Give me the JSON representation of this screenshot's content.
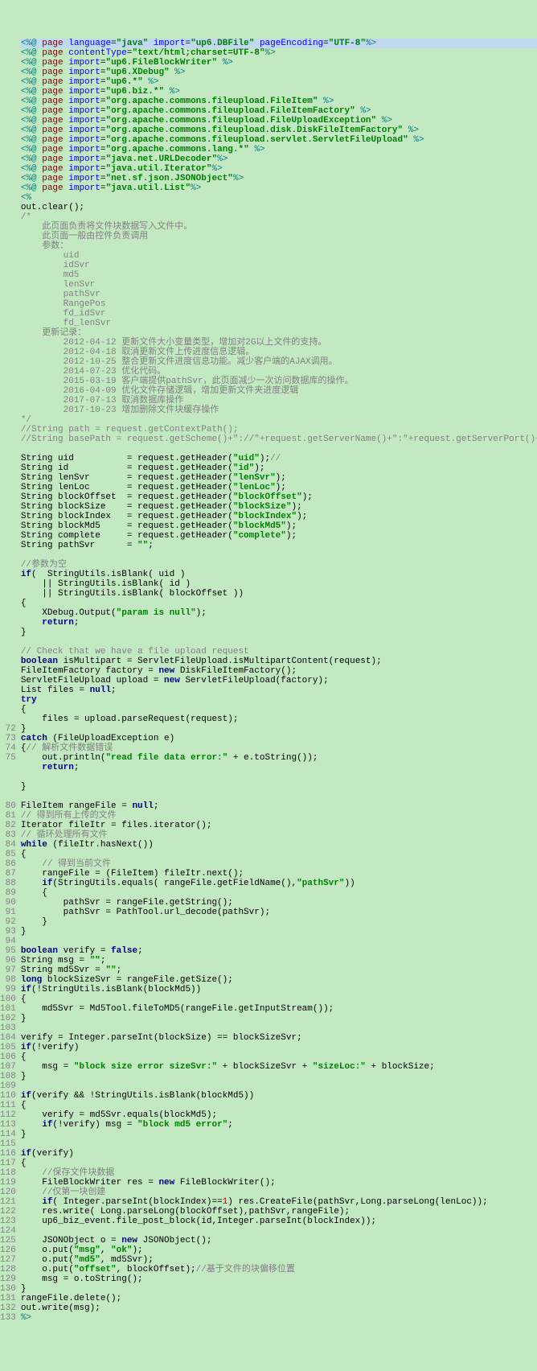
{
  "gutter": [
    "",
    "",
    "",
    "",
    "",
    "",
    "",
    "",
    "",
    "",
    "",
    "",
    "",
    "",
    "",
    "",
    "",
    "",
    "",
    "",
    "",
    "",
    "",
    "",
    "",
    "",
    "",
    "",
    "",
    "",
    "",
    "",
    "",
    "",
    "",
    "",
    "",
    "",
    "",
    "",
    "",
    "",
    "",
    "",
    "",
    "",
    "",
    "",
    "",
    "",
    "",
    "",
    "",
    "",
    "",
    "",
    "",
    "",
    "",
    "",
    "",
    "",
    "",
    "",
    "",
    "",
    "",
    "",
    "",
    "",
    "",
    "72",
    "73",
    "74",
    "75",
    "",
    "",
    "",
    "",
    "80",
    "81",
    "82",
    "83",
    "84",
    "85",
    "86",
    "87",
    "88",
    "89",
    "90",
    "91",
    "92",
    "93",
    "94",
    "95",
    "96",
    "97",
    "98",
    "99",
    "100",
    "101",
    "102",
    "103",
    "104",
    "105",
    "106",
    "107",
    "108",
    "109",
    "110",
    "111",
    "112",
    "113",
    "114",
    "115",
    "116",
    "117",
    "118",
    "119",
    "120",
    "121",
    "122",
    "123",
    "124",
    "125",
    "126",
    "127",
    "128",
    "129",
    "130",
    "131",
    "132",
    "133"
  ],
  "lines": [
    {
      "cls": "highlight-line",
      "h": "<span class='tag'>&lt;%@</span> <span class='brown'>page</span> <span class='attr'>language</span>=<span class='str'>\"java\"</span> <span class='attr'>import</span>=<span class='str'>\"up6.DBFile\"</span> <span class='attr'>pageEncoding</span>=<span class='str'>\"UTF-8\"</span><span class='tag'>%&gt;</span>"
    },
    {
      "h": "<span class='tag'>&lt;%@</span> <span class='brown'>page</span> <span class='attr'>contentType</span>=<span class='str'>\"text/html;charset=UTF-8\"</span><span class='tag'>%&gt;</span>"
    },
    {
      "h": "<span class='tag'>&lt;%@</span> <span class='brown'>page</span> <span class='attr'>import</span>=<span class='str'>\"up6.FileBlockWriter\"</span> <span class='tag'>%&gt;</span>"
    },
    {
      "h": "<span class='tag'>&lt;%@</span> <span class='brown'>page</span> <span class='attr'>import</span>=<span class='str'>\"up6.XDebug\"</span> <span class='tag'>%&gt;</span>"
    },
    {
      "h": "<span class='tag'>&lt;%@</span> <span class='brown'>page</span> <span class='attr'>import</span>=<span class='str'>\"up6.*\"</span> <span class='tag'>%&gt;</span>"
    },
    {
      "h": "<span class='tag'>&lt;%@</span> <span class='brown'>page</span> <span class='attr'>import</span>=<span class='str'>\"up6.biz.*\"</span> <span class='tag'>%&gt;</span>"
    },
    {
      "h": "<span class='tag'>&lt;%@</span> <span class='brown'>page</span> <span class='attr'>import</span>=<span class='str'>\"org.apache.commons.fileupload.FileItem\"</span> <span class='tag'>%&gt;</span>"
    },
    {
      "h": "<span class='tag'>&lt;%@</span> <span class='brown'>page</span> <span class='attr'>import</span>=<span class='str'>\"org.apache.commons.fileupload.FileItemFactory\"</span> <span class='tag'>%&gt;</span>"
    },
    {
      "h": "<span class='tag'>&lt;%@</span> <span class='brown'>page</span> <span class='attr'>import</span>=<span class='str'>\"org.apache.commons.fileupload.FileUploadException\"</span> <span class='tag'>%&gt;</span>"
    },
    {
      "h": "<span class='tag'>&lt;%@</span> <span class='brown'>page</span> <span class='attr'>import</span>=<span class='str'>\"org.apache.commons.fileupload.disk.DiskFileItemFactory\"</span> <span class='tag'>%&gt;</span>"
    },
    {
      "h": "<span class='tag'>&lt;%@</span> <span class='brown'>page</span> <span class='attr'>import</span>=<span class='str'>\"org.apache.commons.fileupload.servlet.ServletFileUpload\"</span> <span class='tag'>%&gt;</span>"
    },
    {
      "h": "<span class='tag'>&lt;%@</span> <span class='brown'>page</span> <span class='attr'>import</span>=<span class='str'>\"org.apache.commons.lang.*\"</span> <span class='tag'>%&gt;</span>"
    },
    {
      "h": "<span class='tag'>&lt;%@</span> <span class='brown'>page</span> <span class='attr'>import</span>=<span class='str'>\"java.net.URLDecoder\"</span><span class='tag'>%&gt;</span>"
    },
    {
      "h": "<span class='tag'>&lt;%@</span> <span class='brown'>page</span> <span class='attr'>import</span>=<span class='str'>\"java.util.Iterator\"</span><span class='tag'>%&gt;</span>"
    },
    {
      "h": "<span class='tag'>&lt;%@</span> <span class='brown'>page</span> <span class='attr'>import</span>=<span class='str'>\"net.sf.json.JSONObject\"</span><span class='tag'>%&gt;</span>"
    },
    {
      "h": "<span class='tag'>&lt;%@</span> <span class='brown'>page</span> <span class='attr'>import</span>=<span class='str'>\"java.util.List\"</span><span class='tag'>%&gt;</span>"
    },
    {
      "h": "<span class='tag'>&lt;%</span>"
    },
    {
      "h": "out.clear();"
    },
    {
      "h": "<span class='cmt'>/*</span>"
    },
    {
      "h": "<span class='cmt'>    此页面负责将文件块数据写入文件中。</span>"
    },
    {
      "h": "<span class='cmt'>    此页面一般由控件负责调用</span>"
    },
    {
      "h": "<span class='cmt'>    参数：</span>"
    },
    {
      "h": "<span class='cmt'>        uid</span>"
    },
    {
      "h": "<span class='cmt'>        idSvr</span>"
    },
    {
      "h": "<span class='cmt'>        md5</span>"
    },
    {
      "h": "<span class='cmt'>        lenSvr</span>"
    },
    {
      "h": "<span class='cmt'>        pathSvr</span>"
    },
    {
      "h": "<span class='cmt'>        RangePos</span>"
    },
    {
      "h": "<span class='cmt'>        fd_idSvr</span>"
    },
    {
      "h": "<span class='cmt'>        fd_lenSvr</span>"
    },
    {
      "h": "<span class='cmt'>    更新记录：</span>"
    },
    {
      "h": "<span class='cmt'>        2012-04-12 更新文件大小变量类型，增加对2G以上文件的支持。</span>"
    },
    {
      "h": "<span class='cmt'>        2012-04-18 取消更新文件上传进度信息逻辑。</span>"
    },
    {
      "h": "<span class='cmt'>        2012-10-25 整合更新文件进度信息功能。减少客户端的AJAX调用。</span>"
    },
    {
      "h": "<span class='cmt'>        2014-07-23 优化代码。</span>"
    },
    {
      "h": "<span class='cmt'>        2015-03-19 客户端提供pathSvr，此页面减少一次访问数据库的操作。</span>"
    },
    {
      "h": "<span class='cmt'>        2016-04-09 优化文件存储逻辑，增加更新文件夹进度逻辑</span>"
    },
    {
      "h": "<span class='cmt'>        2017-07-13 取消数据库操作</span>"
    },
    {
      "h": "<span class='cmt'>        2017-10-23 增加删除文件块缓存操作</span>"
    },
    {
      "h": "<span class='cmt'>*/</span>"
    },
    {
      "h": "<span class='cmt'>//String path = request.getContextPath();</span>"
    },
    {
      "h": "<span class='cmt'>//String basePath = request.getScheme()+\"://\"+request.getServerName()+\":\"+request.getServerPort()+path+\"/\";</span>"
    },
    {
      "h": ""
    },
    {
      "h": "String uid          = request.getHeader(<span class='str'>\"uid\"</span>);<span class='cmt'>//</span>"
    },
    {
      "h": "String id           = request.getHeader(<span class='str'>\"id\"</span>);"
    },
    {
      "h": "String lenSvr       = request.getHeader(<span class='str'>\"lenSvr\"</span>);"
    },
    {
      "h": "String lenLoc       = request.getHeader(<span class='str'>\"lenLoc\"</span>);"
    },
    {
      "h": "String blockOffset  = request.getHeader(<span class='str'>\"blockOffset\"</span>);"
    },
    {
      "h": "String blockSize    = request.getHeader(<span class='str'>\"blockSize\"</span>);"
    },
    {
      "h": "String blockIndex   = request.getHeader(<span class='str'>\"blockIndex\"</span>);"
    },
    {
      "h": "String blockMd5     = request.getHeader(<span class='str'>\"blockMd5\"</span>);"
    },
    {
      "h": "String complete     = request.getHeader(<span class='str'>\"complete\"</span>);"
    },
    {
      "h": "String pathSvr      = <span class='str'>\"\"</span>;"
    },
    {
      "h": ""
    },
    {
      "h": "<span class='cmt'>//参数为空</span>"
    },
    {
      "h": "<span class='kw'>if</span>(  StringUtils.isBlank( uid )"
    },
    {
      "h": "    || StringUtils.isBlank( id )"
    },
    {
      "h": "    || StringUtils.isBlank( blockOffset ))"
    },
    {
      "h": "{"
    },
    {
      "h": "    XDebug.Output(<span class='str'>\"param is null\"</span>);"
    },
    {
      "h": "    <span class='kw'>return</span>;"
    },
    {
      "h": "}"
    },
    {
      "h": ""
    },
    {
      "h": "<span class='cmt'>// Check that we have a file upload request</span>"
    },
    {
      "h": "<span class='kw'>boolean</span> isMultipart = ServletFileUpload.isMultipartContent(request);"
    },
    {
      "h": "FileItemFactory factory = <span class='kw'>new</span> DiskFileItemFactory();"
    },
    {
      "h": "ServletFileUpload upload = <span class='kw'>new</span> ServletFileUpload(factory);"
    },
    {
      "h": "List files = <span class='kw'>null</span>;"
    },
    {
      "h": "<span class='kw'>try</span>"
    },
    {
      "h": "{"
    },
    {
      "h": "    files = upload.parseRequest(request);"
    },
    {
      "h": "}"
    },
    {
      "h": "<span class='kw'>catch</span> (FileUploadException e)"
    },
    {
      "h": "{<span class='cmt'>// 解析文件数据错误</span>"
    },
    {
      "h": "    out.println(<span class='str'>\"read file data error:\"</span> + e.toString());"
    },
    {
      "h": "    <span class='kw'>return</span>;"
    },
    {
      "h": ""
    },
    {
      "h": "}"
    },
    {
      "h": ""
    },
    {
      "h": "FileItem rangeFile = <span class='kw'>null</span>;"
    },
    {
      "h": "<span class='cmt'>// 得到所有上传的文件</span>"
    },
    {
      "h": "Iterator fileItr = files.iterator();"
    },
    {
      "h": "<span class='cmt'>// 循环处理所有文件</span>"
    },
    {
      "h": "<span class='kw'>while</span> (fileItr.hasNext())"
    },
    {
      "h": "{"
    },
    {
      "h": "    <span class='cmt'>// 得到当前文件</span>"
    },
    {
      "h": "    rangeFile = (FileItem) fileItr.next();"
    },
    {
      "h": "    <span class='kw'>if</span>(StringUtils.equals( rangeFile.getFieldName(),<span class='str'>\"pathSvr\"</span>))"
    },
    {
      "h": "    {"
    },
    {
      "h": "        pathSvr = rangeFile.getString();"
    },
    {
      "h": "        pathSvr = PathTool.url_decode(pathSvr);"
    },
    {
      "h": "    }"
    },
    {
      "h": "}"
    },
    {
      "h": ""
    },
    {
      "h": "<span class='kw'>boolean</span> verify = <span class='kw'>false</span>;"
    },
    {
      "h": "String msg = <span class='str'>\"\"</span>;"
    },
    {
      "h": "String md5Svr = <span class='str'>\"\"</span>;"
    },
    {
      "h": "<span class='kw'>long</span> blockSizeSvr = rangeFile.getSize();"
    },
    {
      "h": "<span class='kw'>if</span>(!StringUtils.isBlank(blockMd5))"
    },
    {
      "h": "{"
    },
    {
      "h": "    md5Svr = Md5Tool.fileToMD5(rangeFile.getInputStream());"
    },
    {
      "h": "}"
    },
    {
      "h": ""
    },
    {
      "h": "verify = Integer.parseInt(blockSize) == blockSizeSvr;"
    },
    {
      "h": "<span class='kw'>if</span>(!verify)"
    },
    {
      "h": "{"
    },
    {
      "h": "    msg = <span class='str'>\"block size error sizeSvr:\"</span> + blockSizeSvr + <span class='str'>\"sizeLoc:\"</span> + blockSize;"
    },
    {
      "h": "}"
    },
    {
      "h": ""
    },
    {
      "h": "<span class='kw'>if</span>(verify &amp;&amp; !StringUtils.isBlank(blockMd5))"
    },
    {
      "h": "{"
    },
    {
      "h": "    verify = md5Svr.equals(blockMd5);"
    },
    {
      "h": "    <span class='kw'>if</span>(!verify) msg = <span class='str'>\"block md5 error\"</span>;"
    },
    {
      "h": "}"
    },
    {
      "h": ""
    },
    {
      "h": "<span class='kw'>if</span>(verify)"
    },
    {
      "h": "{"
    },
    {
      "h": "    <span class='cmt'>//保存文件块数据</span>"
    },
    {
      "h": "    FileBlockWriter res = <span class='kw'>new</span> FileBlockWriter();"
    },
    {
      "h": "    <span class='cmt'>//仅第一块创建</span>"
    },
    {
      "h": "    <span class='kw'>if</span>( Integer.parseInt(blockIndex)==<span class='red'>1</span>) res.CreateFile(pathSvr,Long.parseLong(lenLoc));"
    },
    {
      "h": "    res.write( Long.parseLong(blockOffset),pathSvr,rangeFile);"
    },
    {
      "h": "    up6_biz_event.file_post_block(id,Integer.parseInt(blockIndex));"
    },
    {
      "h": ""
    },
    {
      "h": "    JSONObject o = <span class='kw'>new</span> JSONObject();"
    },
    {
      "h": "    o.put(<span class='str'>\"msg\"</span>, <span class='str'>\"ok\"</span>);"
    },
    {
      "h": "    o.put(<span class='str'>\"md5\"</span>, md5Svr);"
    },
    {
      "h": "    o.put(<span class='str'>\"offset\"</span>, blockOffset);<span class='cmt'>//基于文件的块偏移位置</span>"
    },
    {
      "h": "    msg = o.toString();"
    },
    {
      "h": "}"
    },
    {
      "h": "rangeFile.delete();"
    },
    {
      "h": "out.write(msg);"
    },
    {
      "h": "<span class='tag'>%&gt;</span>"
    }
  ]
}
